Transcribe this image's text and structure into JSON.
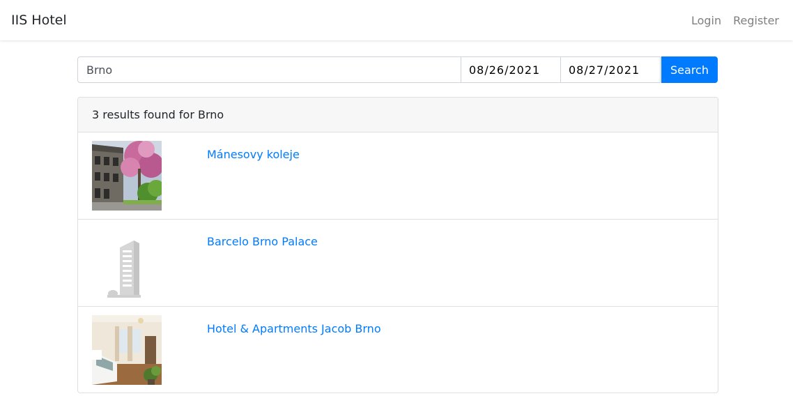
{
  "navbar": {
    "brand": "IIS Hotel",
    "login": "Login",
    "register": "Register"
  },
  "search": {
    "city_value": "Brno",
    "check_in": "08/26/2021",
    "check_out": "08/27/2021",
    "button_label": "Search"
  },
  "results": {
    "summary": "3 results found for Brno",
    "items": [
      {
        "name": "Mánesovy koleje",
        "image": "building-with-blossom-tree-photo"
      },
      {
        "name": "Barcelo Brno Palace",
        "image": "placeholder-building-icon"
      },
      {
        "name": "Hotel & Apartments Jacob Brno",
        "image": "hotel-room-photo"
      }
    ]
  },
  "colors": {
    "primary": "#007bff",
    "header_bg": "#f7f7f7",
    "muted_link": "#7f7f7f"
  }
}
